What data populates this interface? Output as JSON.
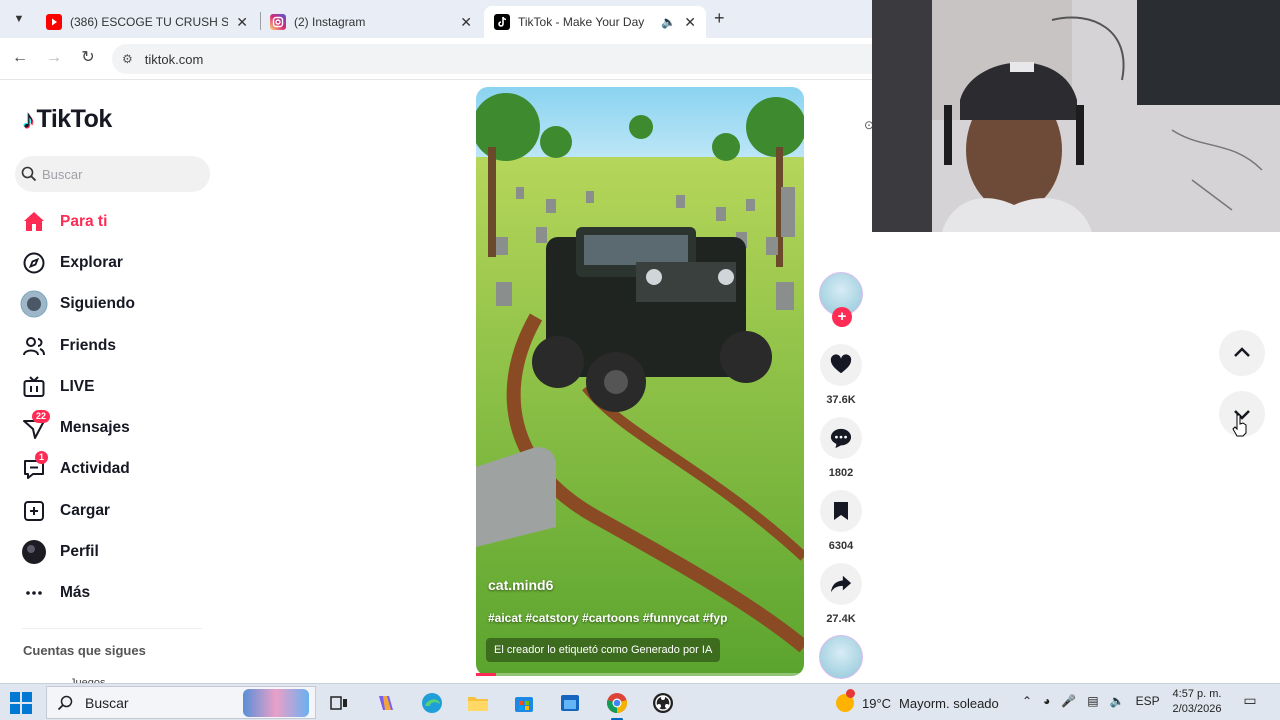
{
  "browser": {
    "tabs": [
      {
        "title": "(386) ESCOGE TU CRUSH SAN",
        "favicon": "youtube-icon",
        "favicon_color": "#ff0000",
        "active": false
      },
      {
        "title": "(2) Instagram",
        "favicon": "instagram-icon",
        "favicon_color": "#d6249f",
        "active": false
      },
      {
        "title": "TikTok - Make Your Day",
        "favicon": "tiktok-icon",
        "favicon_color": "#000000",
        "active": true
      }
    ],
    "url": "tiktok.com"
  },
  "sidebar": {
    "logo": "TikTok",
    "search_placeholder": "Buscar",
    "items": [
      {
        "label": "Para ti",
        "icon": "home-icon",
        "active": true
      },
      {
        "label": "Explorar",
        "icon": "compass-icon"
      },
      {
        "label": "Siguiendo",
        "icon": "following-avatar-icon"
      },
      {
        "label": "Friends",
        "icon": "friends-icon"
      },
      {
        "label": "LIVE",
        "icon": "live-tv-icon"
      },
      {
        "label": "Mensajes",
        "icon": "inbox-icon",
        "badge": "22"
      },
      {
        "label": "Actividad",
        "icon": "activity-icon",
        "badge": "1"
      },
      {
        "label": "Cargar",
        "icon": "upload-icon"
      },
      {
        "label": "Perfil",
        "icon": "profile-avatar-icon"
      },
      {
        "label": "Más",
        "icon": "more-dots-icon"
      }
    ],
    "following_title": "Cuentas que sigues",
    "following_partial": "Juegos"
  },
  "video": {
    "username": "cat.mind6",
    "hashtags": "#aicat #catstory #cartoons #funnycat #fyp",
    "ai_label": "El creador lo etiquetó como Generado por IA",
    "progress": 0.06,
    "likes": "37.6K",
    "comments": "1802",
    "saves": "6304",
    "shares": "27.4K"
  },
  "taskbar": {
    "search_label": "Buscar",
    "weather_temp": "19°C",
    "weather_desc": "Mayorm. soleado",
    "language": "ESP",
    "time": "4:57 p. m.",
    "date": "2/03/2026"
  },
  "colors": {
    "accent": "#fe2c55",
    "taskbar": "#dfe6ef",
    "tab_strip": "#e9eef6"
  }
}
